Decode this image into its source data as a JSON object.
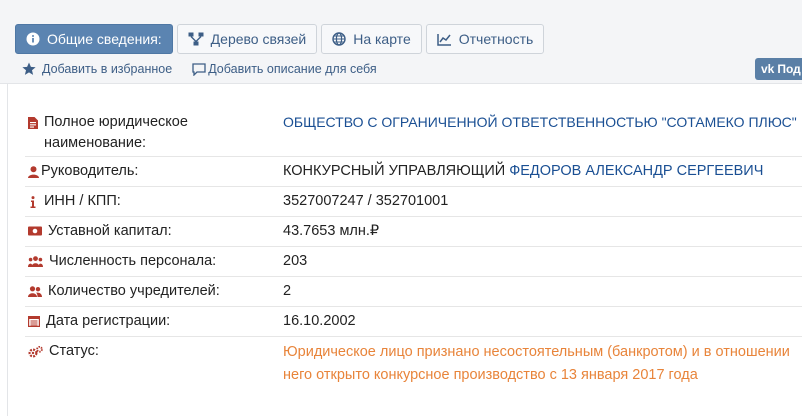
{
  "tabs": [
    {
      "label": "Общие сведения:",
      "icon": "info-circle-icon",
      "active": true
    },
    {
      "label": "Дерево связей",
      "icon": "hierarchy-tree-icon",
      "active": false
    },
    {
      "label": "На карте",
      "icon": "globe-icon",
      "active": false
    },
    {
      "label": "Отчетность",
      "icon": "line-chart-icon",
      "active": false
    }
  ],
  "actions": {
    "favorite_label": "Добавить в избранное",
    "description_label": "Добавить описание для себя"
  },
  "share": {
    "label": "Под"
  },
  "colors": {
    "active_tab": "#5b84b1",
    "link": "#1a4f93",
    "status": "#e8843a",
    "icon_red": "#b33a2e"
  },
  "details": {
    "full_name_label": "Полное юридическое наименование:",
    "full_name_value": "ОБЩЕСТВО С ОГРАНИЧЕННОЙ ОТВЕТСТВЕННОСТЬЮ \"СОТАМЕКО ПЛЮС\"",
    "director_label": "Руководитель:",
    "director_role": "КОНКУРСНЫЙ УПРАВЛЯЮЩИЙ",
    "director_name": "ФЕДОРОВ АЛЕКСАНДР СЕРГЕЕВИЧ",
    "inn_label": "ИНН / КПП:",
    "inn_value": "3527007247 / 352701001",
    "capital_label": "Уставной капитал:",
    "capital_value": "43.7653 млн.₽",
    "staff_label": "Численность персонала:",
    "staff_value": "203",
    "founders_label": "Количество учредителей:",
    "founders_value": "2",
    "reg_date_label": "Дата регистрации:",
    "reg_date_value": "16.10.2002",
    "status_label": "Статус:",
    "status_value": "Юридическое лицо признано несостоятельным (банкротом) и в отношении него открыто конкурсное производство с 13 января 2017 года"
  }
}
